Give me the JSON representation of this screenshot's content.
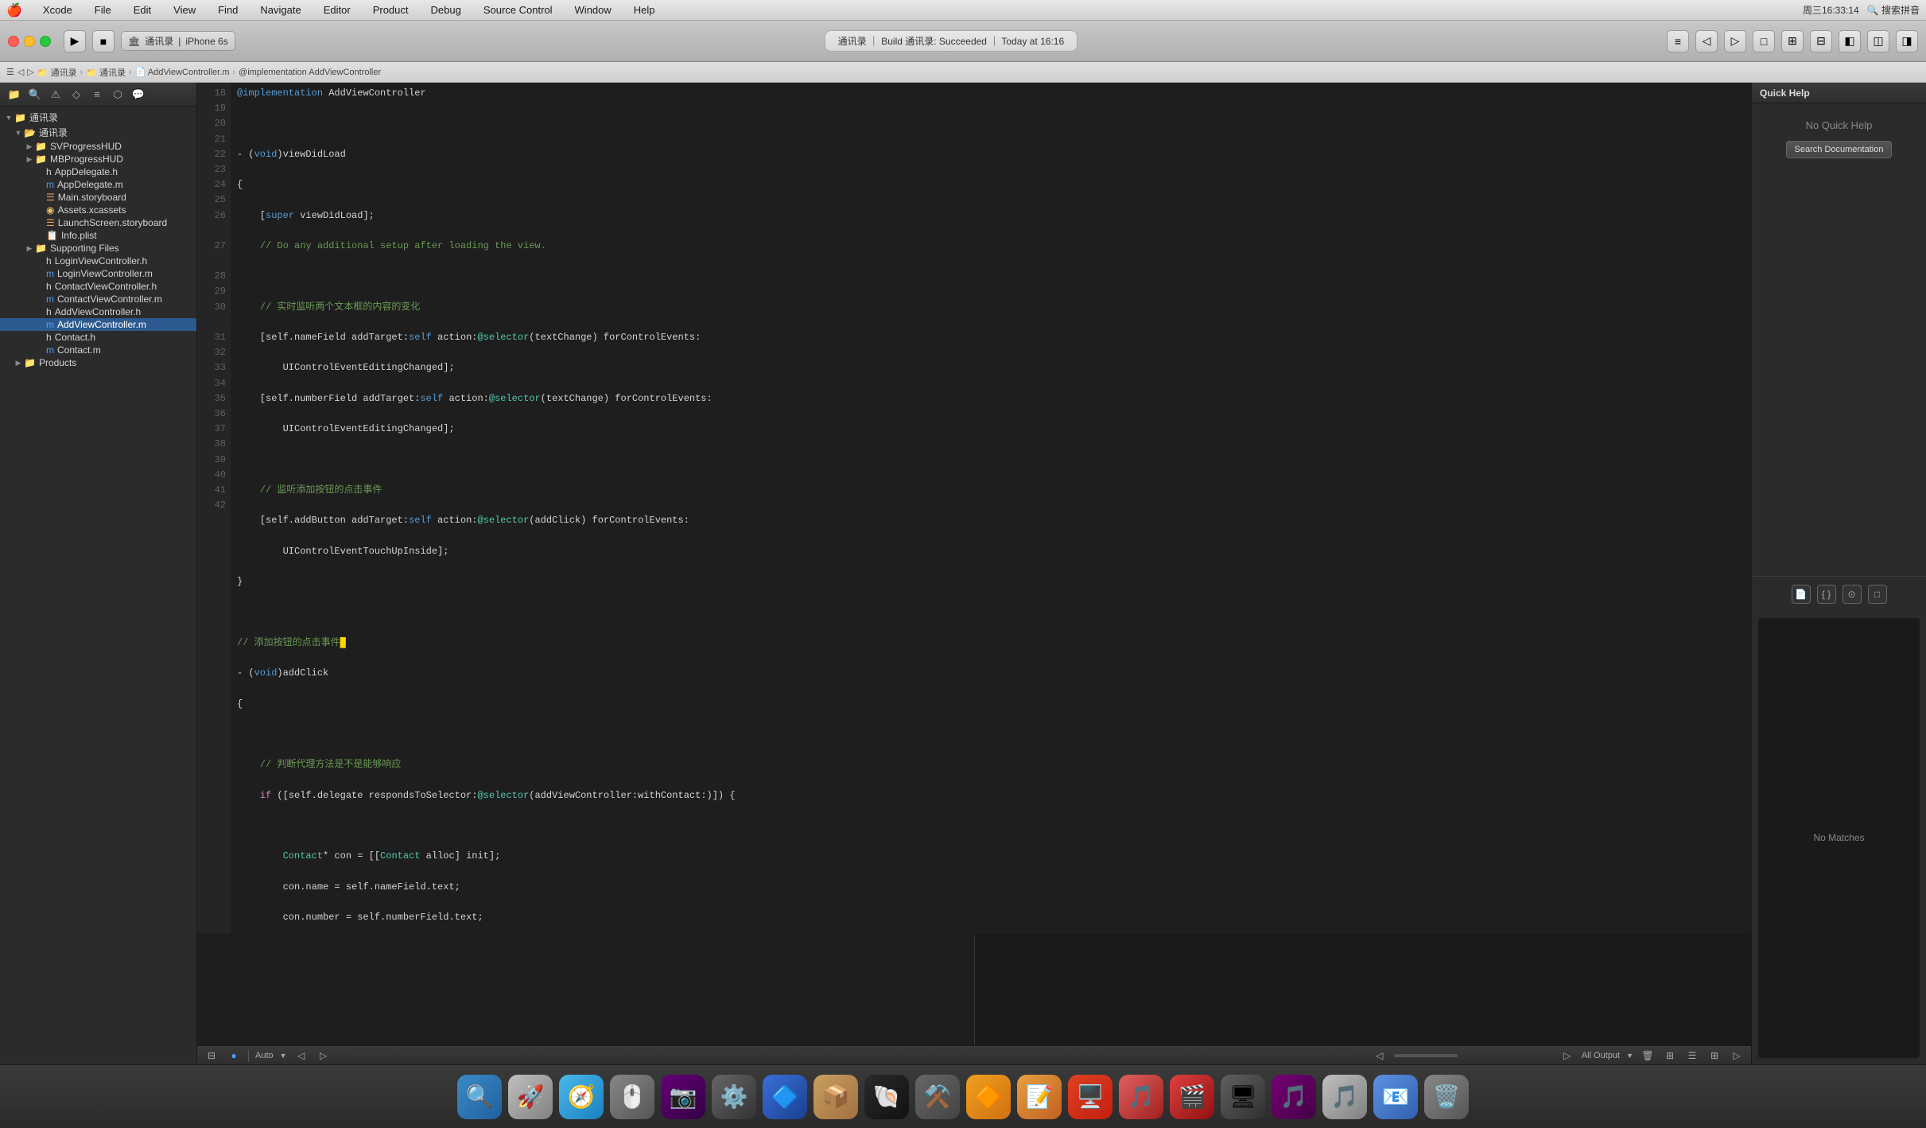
{
  "menubar": {
    "apple": "🍎",
    "items": [
      "Xcode",
      "File",
      "Edit",
      "View",
      "Find",
      "Navigate",
      "Editor",
      "Product",
      "Debug",
      "Source Control",
      "Window",
      "Help"
    ],
    "right": {
      "datetime": "周三16:33:14",
      "search_placeholder": "搜索拼音"
    }
  },
  "toolbar": {
    "scheme": "通讯录",
    "device": "iPhone 6s",
    "build_status": "通讯录 ｜ Build 通讯录: Succeeded ｜ Today at 16:16"
  },
  "breadcrumb": {
    "items": [
      "通讯录",
      "通讯录",
      "AddViewController.m",
      "@implementation AddViewController"
    ]
  },
  "sidebar": {
    "title": "通讯录",
    "items": [
      {
        "label": "通讯录",
        "type": "group",
        "level": 0,
        "expanded": true
      },
      {
        "label": "通讯录",
        "type": "folder",
        "level": 1,
        "expanded": true
      },
      {
        "label": "SVProgressHUD",
        "type": "folder",
        "level": 2,
        "expanded": false
      },
      {
        "label": "MBProgressHUD",
        "type": "folder",
        "level": 2,
        "expanded": false
      },
      {
        "label": "AppDelegate.h",
        "type": "file-h",
        "level": 2
      },
      {
        "label": "AppDelegate.m",
        "type": "file-m",
        "level": 2
      },
      {
        "label": "Main.storyboard",
        "type": "file-story",
        "level": 2
      },
      {
        "label": "Assets.xcassets",
        "type": "file-xcassets",
        "level": 2
      },
      {
        "label": "LaunchScreen.storyboard",
        "type": "file-story",
        "level": 2
      },
      {
        "label": "Info.plist",
        "type": "file-plist",
        "level": 2
      },
      {
        "label": "Supporting Files",
        "type": "folder",
        "level": 2,
        "expanded": false
      },
      {
        "label": "LoginViewController.h",
        "type": "file-h",
        "level": 2
      },
      {
        "label": "LoginViewController.m",
        "type": "file-m",
        "level": 2
      },
      {
        "label": "ContactViewController.h",
        "type": "file-h",
        "level": 2
      },
      {
        "label": "ContactViewController.m",
        "type": "file-m",
        "level": 2
      },
      {
        "label": "AddViewController.h",
        "type": "file-h",
        "level": 2
      },
      {
        "label": "AddViewController.m",
        "type": "file-m",
        "level": 2,
        "selected": true
      },
      {
        "label": "Contact.h",
        "type": "file-h",
        "level": 2
      },
      {
        "label": "Contact.m",
        "type": "file-m",
        "level": 2
      },
      {
        "label": "Products",
        "type": "folder",
        "level": 1,
        "expanded": false
      }
    ]
  },
  "editor": {
    "lines": [
      {
        "num": "18",
        "code": "@implementation AddViewController",
        "type": "normal"
      },
      {
        "num": "19",
        "code": "",
        "type": "normal"
      },
      {
        "num": "20",
        "code": "- (void)viewDidLoad",
        "type": "normal"
      },
      {
        "num": "21",
        "code": "{",
        "type": "normal"
      },
      {
        "num": "22",
        "code": "    [super viewDidLoad];",
        "type": "normal"
      },
      {
        "num": "23",
        "code": "    // Do any additional setup after loading the view.",
        "type": "comment"
      },
      {
        "num": "24",
        "code": "",
        "type": "normal"
      },
      {
        "num": "25",
        "code": "    // 实时监听两个文本框的内容的变化",
        "type": "comment-zh"
      },
      {
        "num": "26",
        "code": "    [self.nameField addTarget:self action:@selector(textChange) forControlEvents:\n        UIControlEventEditingChanged];",
        "type": "normal"
      },
      {
        "num": "27",
        "code": "    [self.numberField addTarget:self action:@selector(textChange) forControlEvents:\n        UIControlEventEditingChanged];",
        "type": "normal"
      },
      {
        "num": "28",
        "code": "",
        "type": "normal"
      },
      {
        "num": "29",
        "code": "    // 监听添加按钮的点击事件",
        "type": "comment-zh"
      },
      {
        "num": "30",
        "code": "    [self.addButton addTarget:self action:@selector(addClick) forControlEvents:\n        UIControlEventTouchUpInside];",
        "type": "normal"
      },
      {
        "num": "31",
        "code": "}",
        "type": "normal"
      },
      {
        "num": "32",
        "code": "",
        "type": "normal"
      },
      {
        "num": "33",
        "code": "// 添加按钮的点击事件",
        "type": "comment-zh"
      },
      {
        "num": "34",
        "code": "- (void)addClick",
        "type": "normal"
      },
      {
        "num": "35",
        "code": "{",
        "type": "normal"
      },
      {
        "num": "36",
        "code": "",
        "type": "normal"
      },
      {
        "num": "37",
        "code": "    // 判断代理方法是不是能够响应",
        "type": "comment-zh"
      },
      {
        "num": "38",
        "code": "    if ([self.delegate respondsToSelector:@selector(addViewController:withContact:)]) {",
        "type": "normal"
      },
      {
        "num": "39",
        "code": "",
        "type": "normal"
      },
      {
        "num": "40",
        "code": "        Contact* con = [[Contact alloc] init];",
        "type": "normal"
      },
      {
        "num": "41",
        "code": "        con.name = self.nameField.text;",
        "type": "normal"
      },
      {
        "num": "42",
        "code": "        con.number = self.numberField.text;",
        "type": "normal"
      }
    ]
  },
  "quick_help": {
    "title": "Quick Help",
    "no_help_text": "No Quick Help",
    "search_doc_label": "Search Documentation"
  },
  "status_bar": {
    "auto_label": "Auto",
    "output_label": "All Output",
    "no_matches": "No Matches"
  },
  "dock": {
    "icons": [
      "🔍",
      "🚀",
      "🧭",
      "🖱️",
      "📷",
      "⚙️",
      "🔷",
      "📦",
      "🐚",
      "⚒️",
      "🔶",
      "📝",
      "🖥️",
      "🎵",
      "📧"
    ]
  }
}
